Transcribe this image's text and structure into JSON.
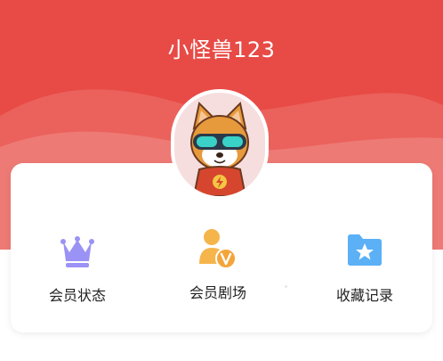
{
  "profile": {
    "username": "小怪兽123",
    "avatar_icon": "shiba-inu-avatar-icon"
  },
  "menu": [
    {
      "label": "会员状态",
      "icon": "crown-icon",
      "color": "#9b92f5"
    },
    {
      "label": "会员剧场",
      "icon": "member-theater-icon",
      "color": "#f5b54a"
    },
    {
      "label": "收藏记录",
      "icon": "star-folder-icon",
      "color": "#5bb0f6"
    }
  ],
  "colors": {
    "header": "#e84a45",
    "card": "#ffffff",
    "text": "#222222"
  }
}
